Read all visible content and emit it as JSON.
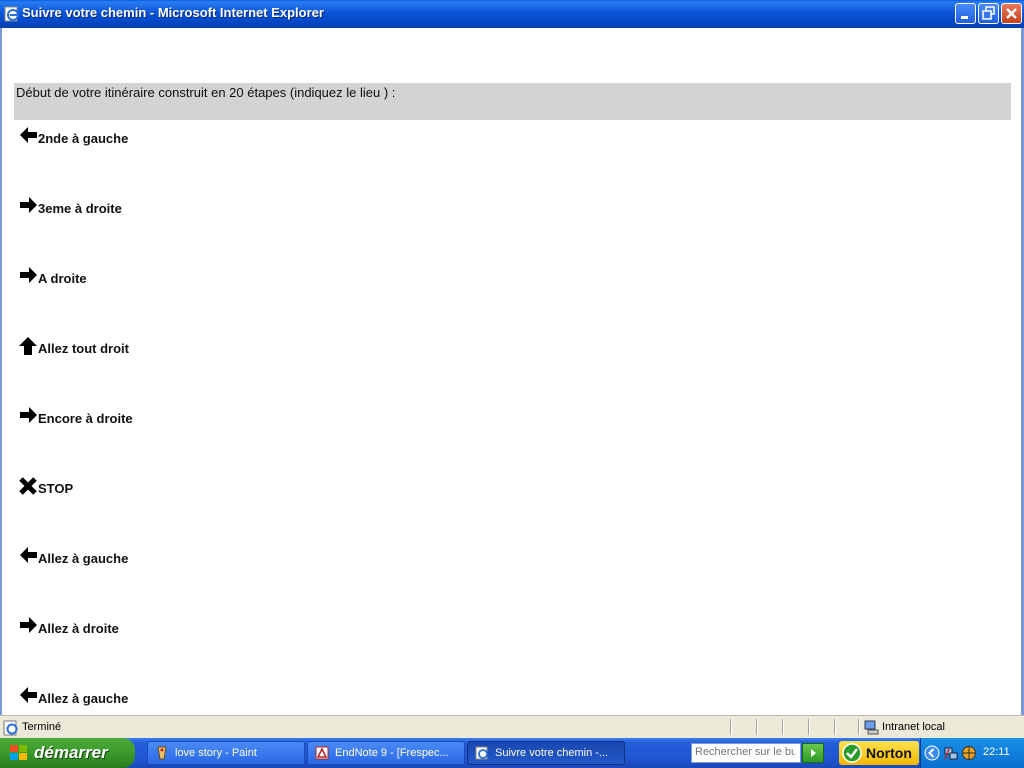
{
  "window": {
    "title": "Suivre votre chemin - Microsoft Internet Explorer"
  },
  "page": {
    "header": "Début de votre itinéraire construit en 20 étapes (indiquez le lieu ) :",
    "steps": [
      {
        "icon": "arrow-left-icon",
        "label": "2nde à gauche"
      },
      {
        "icon": "arrow-right-icon",
        "label": "3eme à droite"
      },
      {
        "icon": "arrow-right-icon",
        "label": "A droite"
      },
      {
        "icon": "arrow-up-icon",
        "label": "Allez tout droit"
      },
      {
        "icon": "arrow-right-icon",
        "label": "Encore à droite"
      },
      {
        "icon": "stop-cross-icon",
        "label": "STOP"
      },
      {
        "icon": "arrow-left-icon",
        "label": "Allez à gauche"
      },
      {
        "icon": "arrow-right-icon",
        "label": "Allez à droite"
      },
      {
        "icon": "arrow-left-icon",
        "label": "Allez à gauche"
      }
    ]
  },
  "statusbar": {
    "status": "Terminé",
    "zone": "Intranet local"
  },
  "taskbar": {
    "start": "démarrer",
    "tasks": [
      {
        "label": "love story - Paint"
      },
      {
        "label": "EndNote 9 - [Frespec..."
      },
      {
        "label": "Suivre votre chemin -..."
      }
    ],
    "search_placeholder": "Rechercher sur le bur",
    "norton": "Norton",
    "clock": "22:11"
  }
}
